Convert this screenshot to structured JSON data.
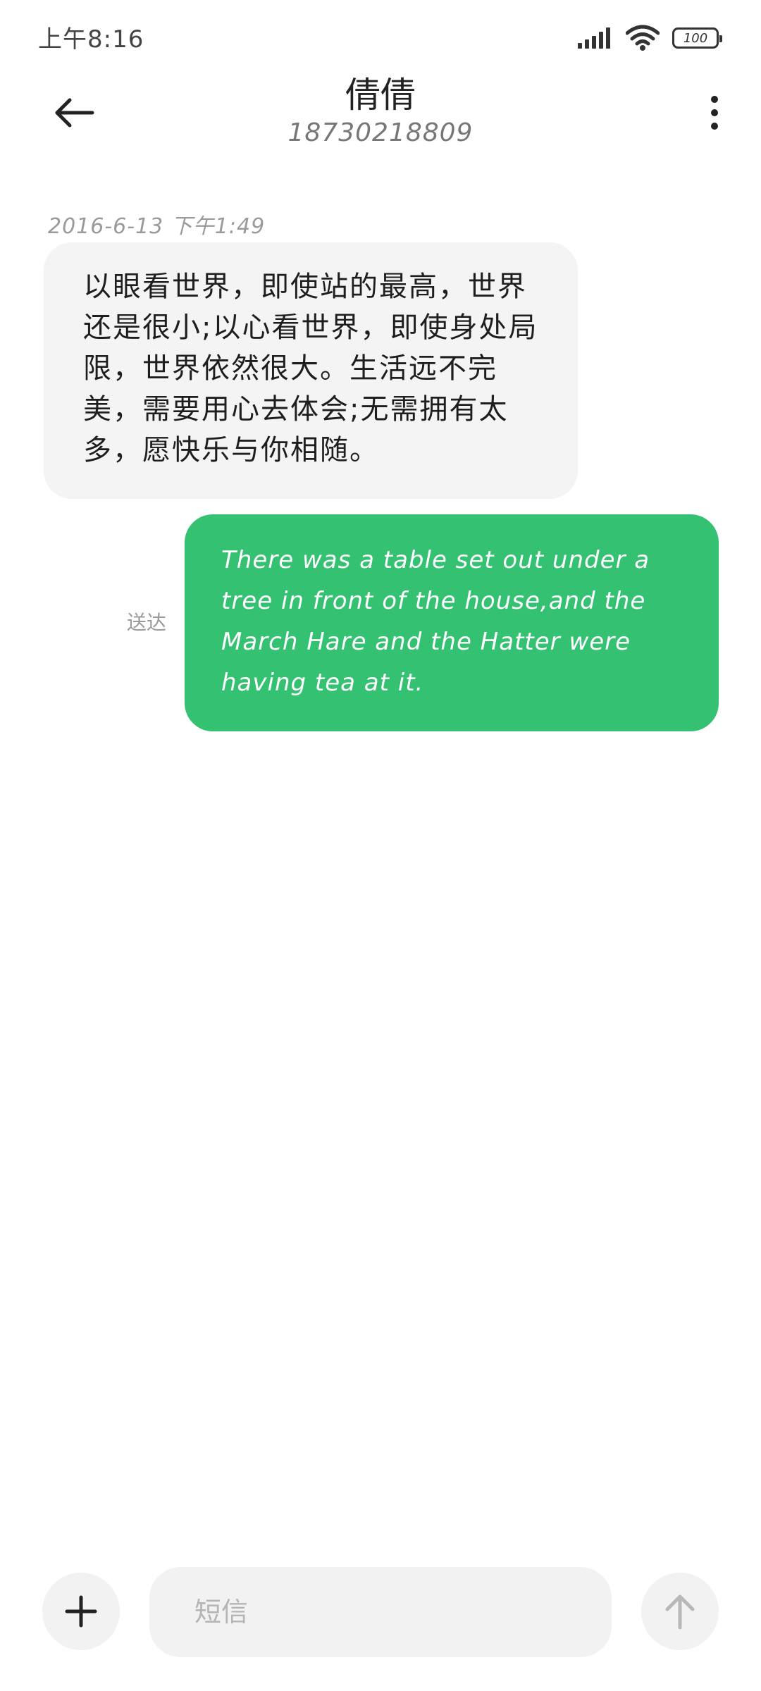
{
  "status_bar": {
    "time": "上午8:16",
    "battery_level": "100",
    "icons": [
      "signal-icon",
      "wifi-icon",
      "battery-icon"
    ]
  },
  "header": {
    "back_icon": "arrow-left-icon",
    "contact_name": "倩倩",
    "contact_number": "18730218809",
    "menu_icon": "more-vertical-icon"
  },
  "conversation": {
    "timestamp": "2016-6-13 下午1:49",
    "messages": [
      {
        "direction": "incoming",
        "text": "以眼看世界，即使站的最高，世界还是很小;以心看世界，即使身处局限，世界依然很大。生活远不完美，需要用心去体会;无需拥有太多，愿快乐与你相随。"
      },
      {
        "direction": "outgoing",
        "status": "送达",
        "text": "There was a table set out under a tree in front of the house,and the March Hare and the Hatter were having tea at it."
      }
    ]
  },
  "composer": {
    "attach_icon": "plus-icon",
    "placeholder": "短信",
    "value": "",
    "send_icon": "arrow-up-icon"
  },
  "colors": {
    "outgoing_bubble": "#34c172",
    "incoming_bubble": "#f4f4f4",
    "background": "#ffffff"
  }
}
